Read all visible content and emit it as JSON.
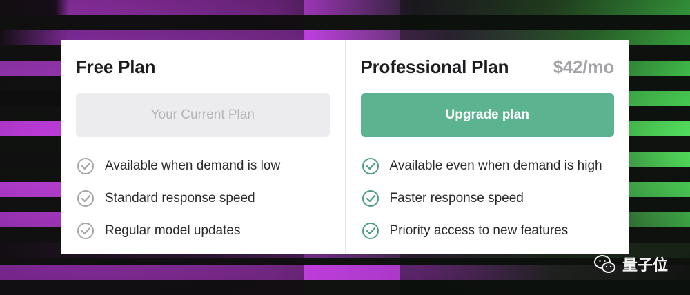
{
  "plans": [
    {
      "title": "Free Plan",
      "price": "",
      "button_label": "Your Current Plan",
      "features": [
        "Available when demand is low",
        "Standard response speed",
        "Regular model updates"
      ],
      "check_color": "#a6a6aa"
    },
    {
      "title": "Professional Plan",
      "price": "$42/mo",
      "button_label": "Upgrade plan",
      "features": [
        "Available even when demand is high",
        "Faster response speed",
        "Priority access to new features"
      ],
      "check_color": "#4f9e7f"
    }
  ],
  "colors": {
    "upgrade_accent": "#5cb38f",
    "current_button_bg": "#ececef",
    "stripe_magenta": "#b23ad3",
    "stripe_green": "#3fd14a"
  },
  "icons": {
    "feature_check": "check-circle-icon",
    "watermark": "wechat-icon"
  },
  "watermark": {
    "text": "量子位"
  }
}
